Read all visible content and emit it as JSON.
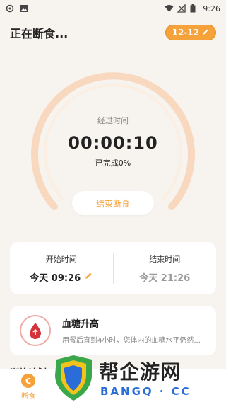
{
  "status_bar": {
    "time": "9:26"
  },
  "header": {
    "title": "正在断食...",
    "plan_label": "12-12"
  },
  "timer": {
    "elapsed_label": "经过时间",
    "elapsed_time": "00:00:10",
    "completed_text": "已完成0%",
    "progress": 0,
    "end_button": "结束断食"
  },
  "times": {
    "start_label": "开始时间",
    "start_value": "今天 09:26",
    "end_label": "结束时间",
    "end_value": "今天 21:26"
  },
  "info": {
    "title": "血糖升高",
    "description": "用餐后直到4小时，您体内的血糖水平仍然..."
  },
  "partial_heading": "训练计划",
  "nav": {
    "fasting_label": "断食",
    "fasting_icon_text": "C"
  },
  "watermark": {
    "title": "帮企游网",
    "sub": "BANGQ · CC"
  },
  "colors": {
    "accent": "#f5a23a",
    "ring": "#f8d8bf",
    "background": "#f7f3ef"
  }
}
